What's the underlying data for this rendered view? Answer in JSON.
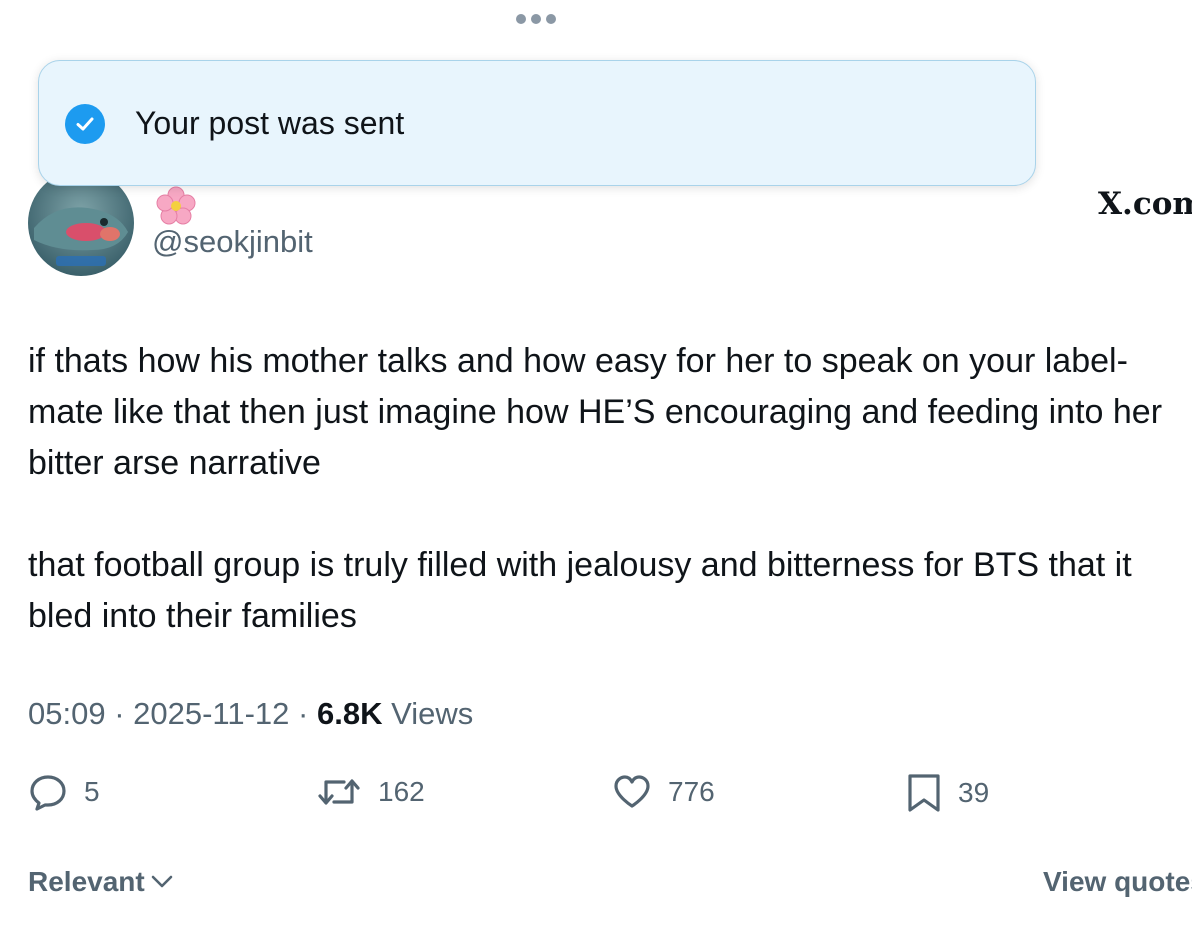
{
  "toast": {
    "message": "Your post was sent"
  },
  "watermark": "X.com",
  "author": {
    "handle": "@seokjinbit"
  },
  "post": {
    "paragraphs": [
      "if thats how his mother talks and how easy for her to speak on your label-mate like that then just imagine how HE’S encouraging and feeding into her bitter arse narrative",
      "that football group is truly filled with jealousy and bitterness for BTS that it bled into their families"
    ],
    "time": "05:09",
    "date": "2025-11-12",
    "views_count": "6.8K",
    "views_label": "Views"
  },
  "actions": {
    "replies": "5",
    "reposts": "162",
    "likes": "776",
    "bookmarks": "39"
  },
  "footer": {
    "sort_label": "Relevant",
    "view_quotes": "View quotes"
  },
  "colors": {
    "accent": "#1d9bf0",
    "toast_bg": "#e8f5fd",
    "secondary_text": "#536471"
  }
}
